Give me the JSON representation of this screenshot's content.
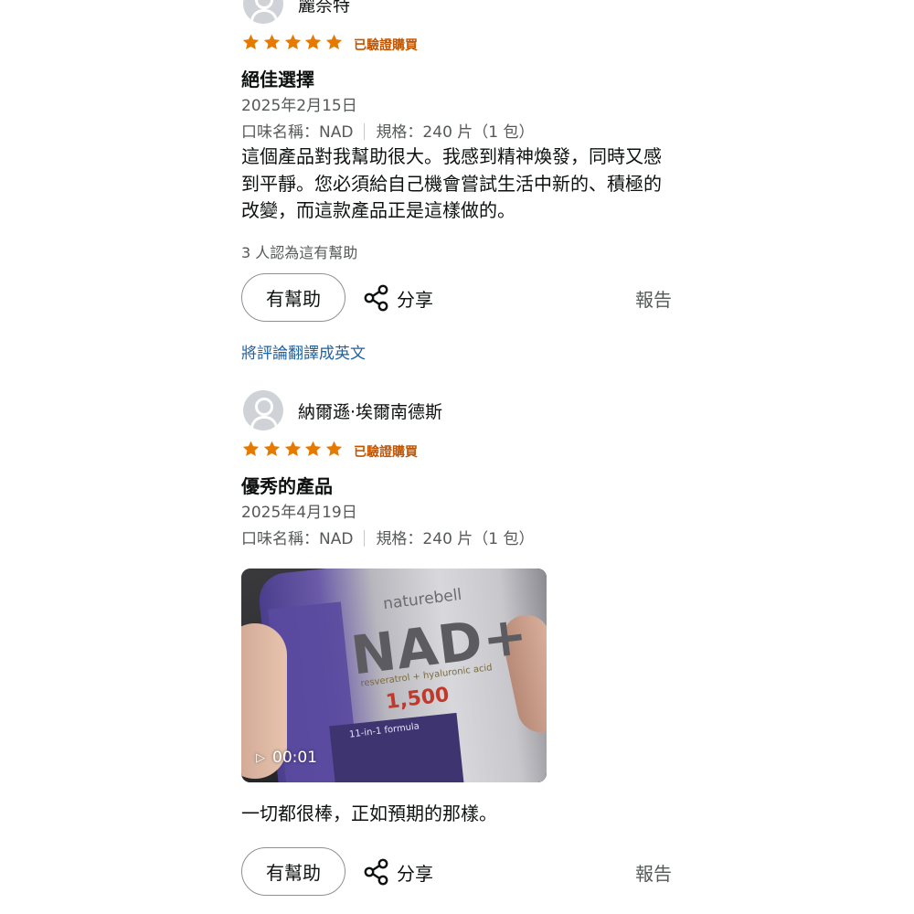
{
  "colors": {
    "star": "#e67a00",
    "verified": "#c45500",
    "link": "#2162a1",
    "muted": "#565959"
  },
  "reviews": [
    {
      "reviewer": "麗奈特",
      "rating": 5,
      "verified_label": "已驗證購買",
      "title": "絕佳選擇",
      "date": "2025年2月15日",
      "variant_flavor": "口味名稱：NAD",
      "variant_size": "規格：240 片（1 包）",
      "body": "這個產品對我幫助很大。我感到精神煥發，同時又感到平靜。您必須給自己機會嘗試生活中新的、積極的改變，而這款產品正是這樣做的。",
      "helpful_count": "3 人認為這有幫助",
      "helpful_button": "有幫助",
      "share_label": "分享",
      "report_label": "報告",
      "translate_link": "將評論翻譯成英文"
    },
    {
      "reviewer": "納爾遜·埃爾南德斯",
      "rating": 5,
      "verified_label": "已驗證購買",
      "title": "優秀的產品",
      "date": "2025年4月19日",
      "variant_flavor": "口味名稱：NAD",
      "variant_size": "規格：240 片（1 包）",
      "video": {
        "duration": "00:01",
        "play_icon": "play-icon",
        "product_brand": "naturebell",
        "product_name": "NAD+",
        "product_sub": "resveratrol + hyaluronic acid",
        "product_dose": "1,500",
        "product_formula": "11-in-1 formula"
      },
      "body": "一切都很棒，正如預期的那樣。",
      "helpful_button": "有幫助",
      "share_label": "分享",
      "report_label": "報告"
    }
  ]
}
